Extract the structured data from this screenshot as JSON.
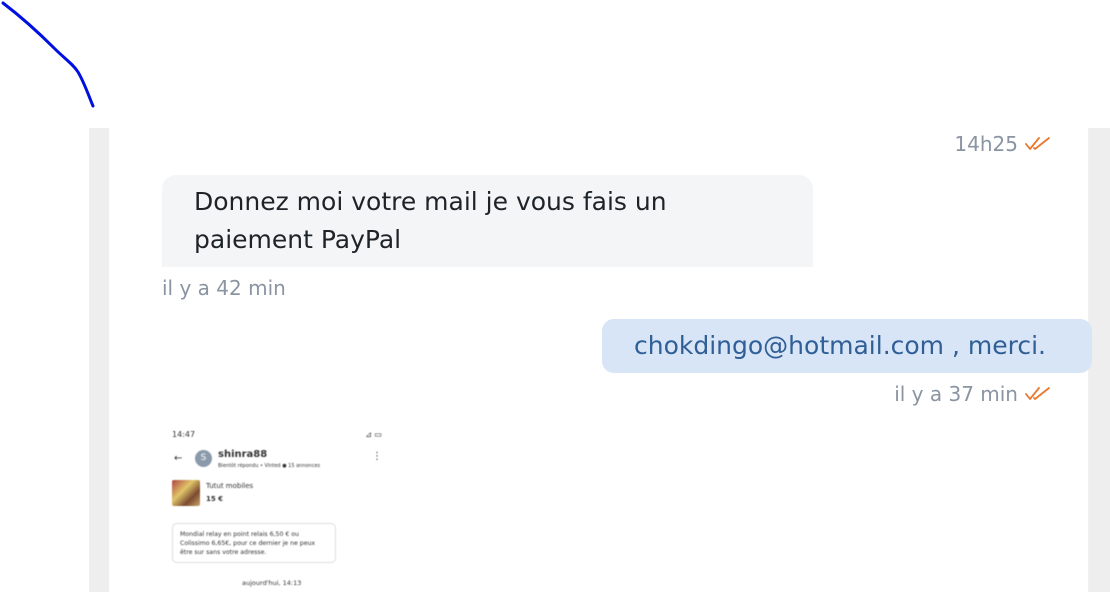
{
  "colors": {
    "pen_stroke": "#0010e0",
    "read_check": "#e8782e",
    "incoming_bubble": "#f4f5f7",
    "outgoing_bubble": "#d8e5f7",
    "outgoing_text": "#2f5f96",
    "meta_text": "#8a94a3"
  },
  "annotation": {
    "type": "pen-stroke"
  },
  "messages": {
    "top_meta": {
      "time": "14h25",
      "status_icon": "double-check-icon"
    },
    "incoming": {
      "text_line1": "Donnez moi votre mail je vous fais un",
      "text_line2": "paiement PayPal",
      "time": "il y a 42 min"
    },
    "outgoing": {
      "text": "chokdingo@hotmail.com , merci.",
      "time": "il y a 37 min",
      "status_icon": "double-check-icon"
    },
    "attachment": {
      "status_time": "14:47",
      "status_icons": "⊿ ▭",
      "back_icon": "←",
      "avatar_letter": "S",
      "username": "shinra88",
      "subtitle": "Bientôt répondu • Vinted ● 15 annonces",
      "menu_icon": "⋮",
      "product_name": "Tutut mobiles",
      "price": "15 €",
      "message": "Mondial relay en point relais 6,50 € ou Colissimo 6,65€, pour ce dernier je ne peux être sur sans votre adresse.",
      "date": "aujourd'hui, 14:13"
    }
  }
}
